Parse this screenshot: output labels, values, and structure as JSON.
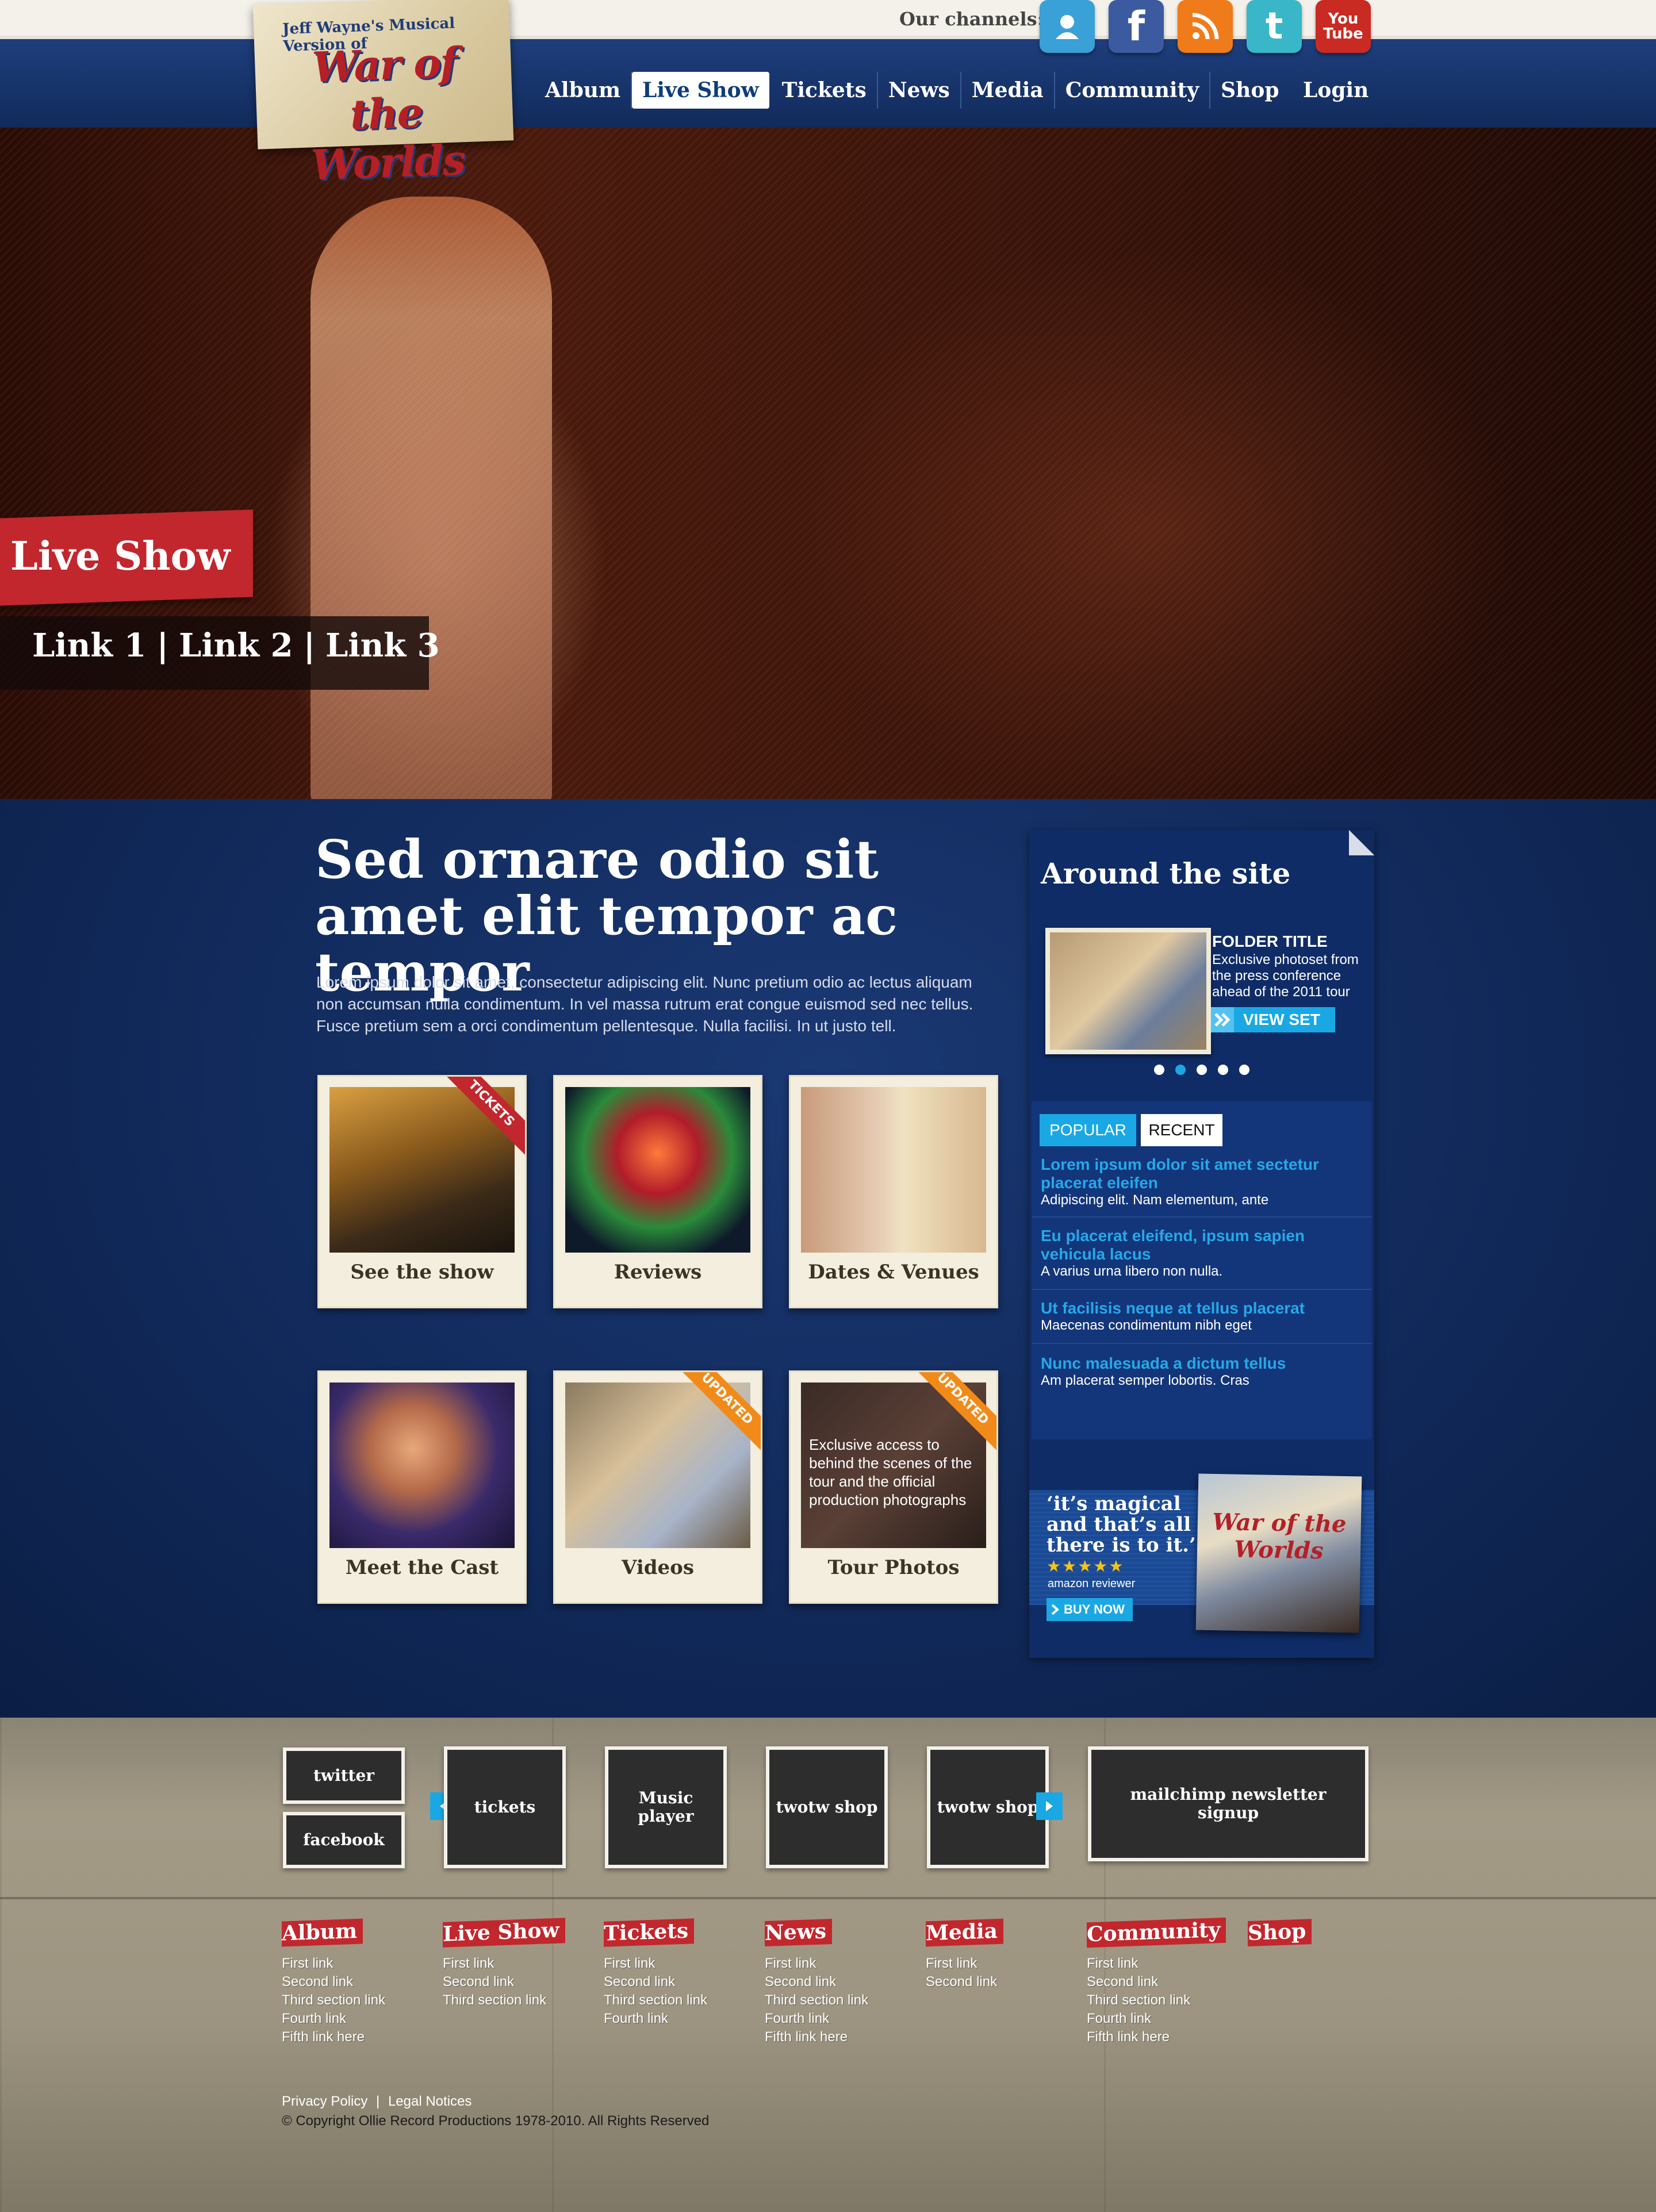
{
  "header": {
    "logo_top": "Jeff Wayne's Musical Version of",
    "logo_text": "War of the Worlds",
    "channels_label": "Our channels:",
    "channels": [
      {
        "name": "myspace",
        "icon": "myspace-icon",
        "color": "#3aa0d8"
      },
      {
        "name": "facebook",
        "icon": "facebook-icon",
        "color": "#3b5aa0"
      },
      {
        "name": "rss",
        "icon": "rss-icon",
        "color": "#f07b1a"
      },
      {
        "name": "twitter",
        "icon": "twitter-icon",
        "color": "#39b6c8"
      },
      {
        "name": "youtube",
        "icon": "youtube-icon",
        "color": "#c92a22"
      }
    ],
    "nav": [
      "Album",
      "Live Show",
      "Tickets",
      "News",
      "Media",
      "Community",
      "Shop"
    ],
    "nav_active": "Live Show",
    "login": "Login"
  },
  "hero": {
    "title": "Live Show",
    "links": [
      "Link 1",
      "Link 2",
      "Link 3"
    ],
    "separator": "|"
  },
  "main": {
    "headline": "Sed ornare odio sit amet elit tempor ac tempor",
    "intro": "Lorem ipsum dolor sit amet, consectetur adipiscing elit. Nunc pretium odio ac lectus aliquam non accumsan nulla condimentum. In vel massa rutrum erat congue euismod sed nec tellus. Fusce pretium sem a orci condimentum pellentesque. Nulla facilisi. In ut justo tell.",
    "tiles": [
      {
        "label": "See the show",
        "ribbon": "TICKETS",
        "ribbon_color": "red"
      },
      {
        "label": "Reviews",
        "ribbon": "",
        "ribbon_color": ""
      },
      {
        "label": "Dates & Venues",
        "ribbon": "",
        "ribbon_color": ""
      },
      {
        "label": "Meet the Cast",
        "ribbon": "",
        "ribbon_color": ""
      },
      {
        "label": "Videos",
        "ribbon": "UPDATED",
        "ribbon_color": "orange"
      },
      {
        "label": "Tour Photos",
        "ribbon": "UPDATED",
        "ribbon_color": "orange",
        "overlay": "Exclusive access to behind the scenes of the tour and the official production photographs"
      }
    ]
  },
  "sidebar": {
    "title": "Around the site",
    "folder_title": "FOLDER TITLE",
    "folder_desc": "Exclusive photoset from the press conference ahead of the 2011 tour",
    "view_set": "VIEW SET",
    "dots_active": 2,
    "tab_popular": "POPULAR",
    "tab_recent": "RECENT",
    "posts": [
      {
        "title": "Lorem ipsum dolor sit amet sectetur placerat eleifen",
        "text": "Adipiscing elit. Nam elementum, ante"
      },
      {
        "title": "Eu placerat eleifend, ipsum sapien vehicula lacus",
        "text": "A varius urna libero non nulla."
      },
      {
        "title": "Ut facilisis neque at tellus placerat",
        "text": "Maecenas condimentum nibh eget"
      },
      {
        "title": "Nunc malesuada a dictum tellus",
        "text": "Am placerat semper lobortis. Cras"
      }
    ],
    "quote": "‘it’s magical and that’s all there is to it.’",
    "stars": "★★★★★",
    "reviewer": "amazon reviewer",
    "buy_now": "BUY NOW",
    "album_cover_text": "War of the Worlds"
  },
  "footer": {
    "social": [
      "twitter",
      "facebook"
    ],
    "boxes": [
      "tickets",
      "Music player",
      "twotw shop",
      "twotw shop"
    ],
    "newsletter": "mailchimp newsletter signup",
    "columns": [
      {
        "head": "Album",
        "links": [
          "First link",
          "Second link",
          "Third section link",
          "Fourth link",
          "Fifth link here"
        ]
      },
      {
        "head": "Live Show",
        "links": [
          "First link",
          "Second link",
          "Third section link"
        ]
      },
      {
        "head": "Tickets",
        "links": [
          "First link",
          "Second link",
          "Third section link",
          "Fourth link"
        ]
      },
      {
        "head": "News",
        "links": [
          "First link",
          "Second link",
          "Third section link",
          "Fourth link",
          "Fifth link here"
        ]
      },
      {
        "head": "Media",
        "links": [
          "First link",
          "Second link"
        ]
      },
      {
        "head": "Community",
        "links": [
          "First link",
          "Second link",
          "Third section link",
          "Fourth link",
          "Fifth link here"
        ]
      },
      {
        "head": "Shop",
        "links": []
      }
    ],
    "privacy": "Privacy Policy",
    "legal_sep": "|",
    "legal": "Legal Notices",
    "copyright": "© Copyright Ollie Record Productions 1978-2010. All Rights Reserved"
  }
}
